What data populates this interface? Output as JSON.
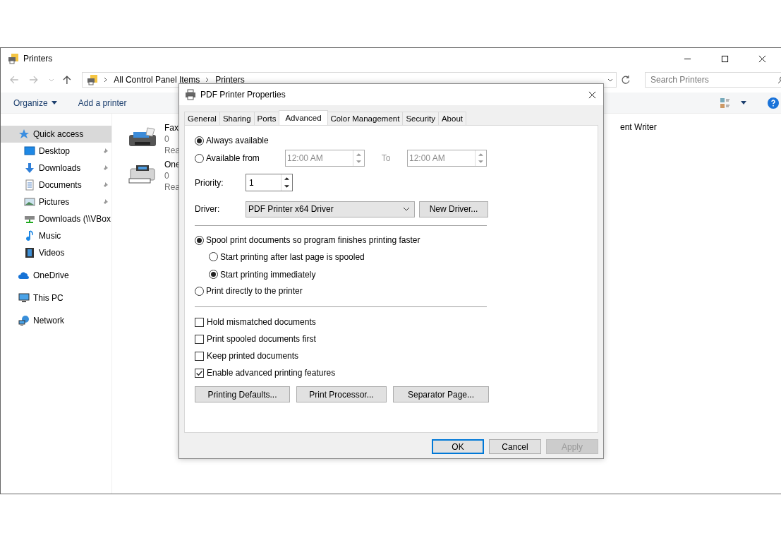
{
  "explorer": {
    "title": "Printers",
    "address": [
      "All Control Panel Items",
      "Printers"
    ],
    "search": {
      "placeholder": "Search Printers"
    },
    "commands": [
      {
        "label": "Organize",
        "dropdown": true
      },
      {
        "label": "Add a printer",
        "dropdown": false
      }
    ],
    "sidebar": {
      "items": [
        {
          "label": "Quick access",
          "kind": "star",
          "selected": true,
          "children": [
            {
              "label": "Desktop",
              "kind": "desktop",
              "pinned": true
            },
            {
              "label": "Downloads",
              "kind": "download",
              "pinned": true
            },
            {
              "label": "Documents",
              "kind": "document",
              "pinned": true
            },
            {
              "label": "Pictures",
              "kind": "picture",
              "pinned": true
            },
            {
              "label": "Downloads (\\\\VBox",
              "kind": "drive",
              "pinned": false
            },
            {
              "label": "Music",
              "kind": "music",
              "pinned": false
            },
            {
              "label": "Videos",
              "kind": "video",
              "pinned": false
            }
          ]
        },
        {
          "label": "OneDrive",
          "kind": "cloud",
          "selected": false
        },
        {
          "label": "This PC",
          "kind": "pc",
          "selected": false
        },
        {
          "label": "Network",
          "kind": "network",
          "selected": false
        }
      ]
    },
    "printers": [
      {
        "name": "Fax",
        "count": "0",
        "status": "Rea",
        "kind": "fax"
      },
      {
        "name": "One",
        "count": "0",
        "status": "Rea",
        "kind": "printer"
      }
    ],
    "partial_item_text": "ent Writer"
  },
  "dialog": {
    "title": "PDF Printer Properties",
    "tabs": [
      {
        "label": "General",
        "selected": false
      },
      {
        "label": "Sharing",
        "selected": false
      },
      {
        "label": "Ports",
        "selected": false
      },
      {
        "label": "Advanced",
        "selected": true
      },
      {
        "label": "Color Management",
        "selected": false
      },
      {
        "label": "Security",
        "selected": false
      },
      {
        "label": "About",
        "selected": false
      }
    ],
    "availability": [
      {
        "label": "Always available",
        "selected": true
      },
      {
        "label": "Available from",
        "selected": false
      }
    ],
    "time_from": {
      "value": "12:00 AM",
      "disabled": true
    },
    "to_label": "To",
    "time_to": {
      "value": "12:00 AM",
      "disabled": true
    },
    "priority": {
      "label": "Priority:",
      "value": "1"
    },
    "driver": {
      "label": "Driver:",
      "value": "PDF Printer x64 Driver",
      "button": "New Driver..."
    },
    "spooling": [
      {
        "label": "Spool print documents so program finishes printing faster",
        "selected": true,
        "children": [
          {
            "label": "Start printing after last page is spooled",
            "selected": false
          },
          {
            "label": "Start printing immediately",
            "selected": true
          }
        ]
      },
      {
        "label": "Print directly to the printer",
        "selected": false
      }
    ],
    "options": [
      {
        "label": "Hold mismatched documents",
        "checked": false
      },
      {
        "label": "Print spooled documents first",
        "checked": false
      },
      {
        "label": "Keep printed documents",
        "checked": false
      },
      {
        "label": "Enable advanced printing features",
        "checked": true
      }
    ],
    "panel_buttons": [
      "Printing Defaults...",
      "Print Processor...",
      "Separator Page..."
    ],
    "footer_buttons": [
      {
        "label": "OK",
        "default": true,
        "disabled": false
      },
      {
        "label": "Cancel",
        "default": false,
        "disabled": false
      },
      {
        "label": "Apply",
        "default": false,
        "disabled": true
      }
    ]
  }
}
